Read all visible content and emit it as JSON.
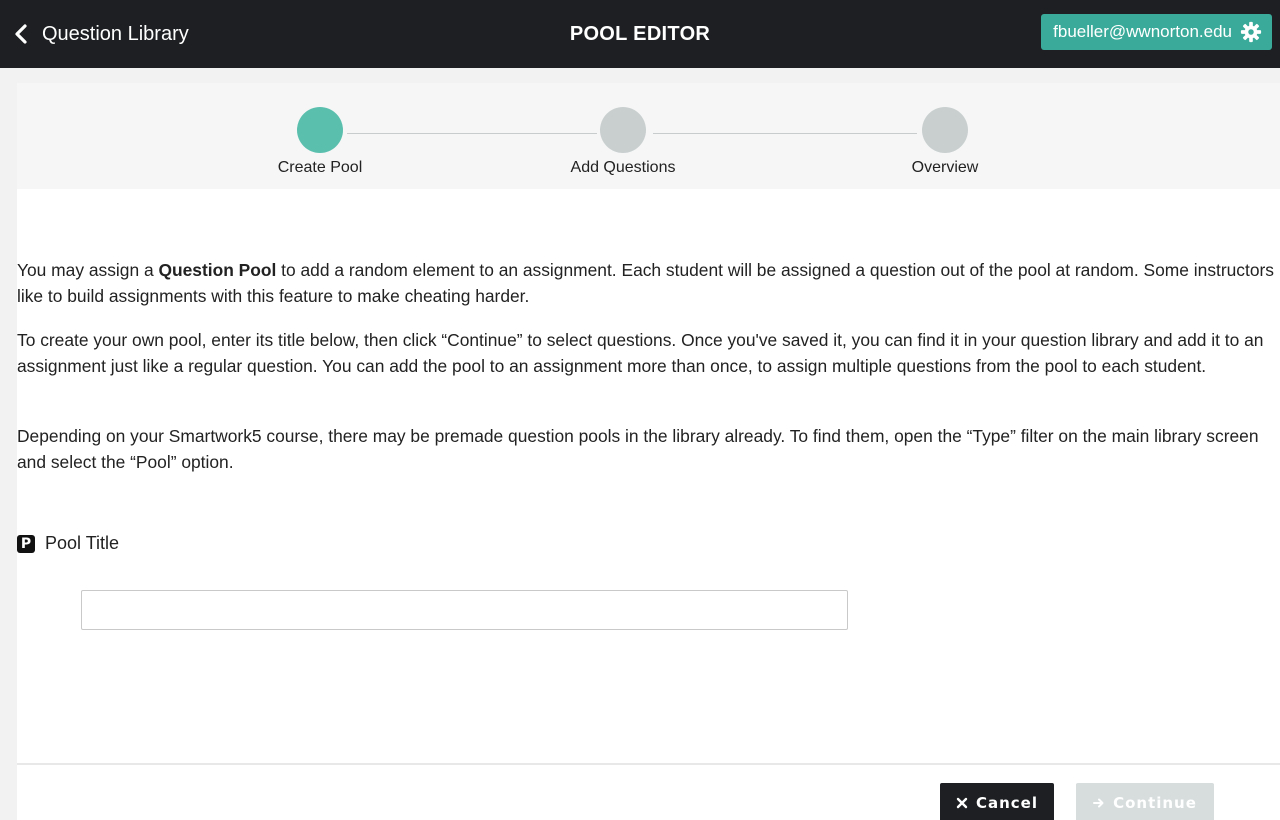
{
  "header": {
    "back_label": "Question Library",
    "title": "POOL EDITOR",
    "user_email": "fbueller@wwnorton.edu"
  },
  "stepper": {
    "steps": [
      {
        "label": "Create Pool",
        "active": true
      },
      {
        "label": "Add Questions",
        "active": false
      },
      {
        "label": "Overview",
        "active": false
      }
    ]
  },
  "intro": {
    "p1_before": "You may assign a ",
    "p1_bold": "Question Pool",
    "p1_after": " to add a random element to an assignment. Each student will be assigned a question out of the pool at random. Some instructors like to build assignments with this feature to make cheating harder.",
    "p2": "To create your own pool, enter its title below, then click “Continue” to select questions. Once you've saved it, you can find it in your question library and add it to an assignment just like a regular question. You can add the pool to an assignment more than once, to assign multiple questions from the pool to each student.",
    "p3": "Depending on your Smartwork5 course, there may be premade question pools in the library already. To find them, open the “Type” filter on the main library screen and select the “Pool” option."
  },
  "pool_title_field": {
    "icon_letter": "P",
    "label": "Pool Title",
    "value": "",
    "placeholder": ""
  },
  "footer": {
    "cancel_label": "Cancel",
    "continue_label": "Continue"
  },
  "colors": {
    "topbar": "#1d1f22",
    "accent": "#3aab9a",
    "step_active": "#5bbfae",
    "step_inactive": "#c9cfcf",
    "continue_disabled": "#d7dcdc"
  },
  "icons": {
    "back": "chevron-left-icon",
    "settings": "gear-icon",
    "cancel": "close-icon",
    "continue": "arrow-right-icon"
  }
}
